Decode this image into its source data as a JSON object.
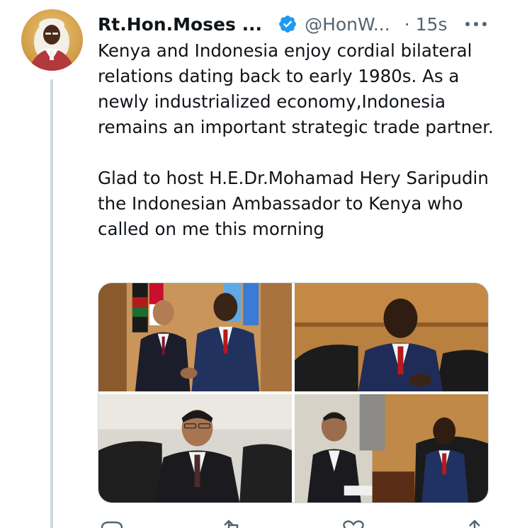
{
  "tweet": {
    "display_name": "Rt.Hon.Moses ...",
    "handle": "@HonW...",
    "separator": "·",
    "time": "15s",
    "paragraphs": [
      "Kenya and Indonesia enjoy cordial bilateral relations dating back to early 1980s. As a newly industrialized economy,Indonesia remains an important strategic trade partner.",
      "Glad to host H.E.Dr.Mohamad Hery Saripudin the Indonesian Ambassador to Kenya who called on me this morning"
    ]
  },
  "icons": {
    "verified": "verified-badge-icon",
    "more": "more-options-icon",
    "reply": "reply-icon",
    "retweet": "retweet-icon",
    "like": "like-icon",
    "share": "share-icon"
  },
  "colors": {
    "verified_blue": "#1d9bf0",
    "text_primary": "#0f1419",
    "text_secondary": "#536471",
    "thread_line": "#cfd9de"
  }
}
